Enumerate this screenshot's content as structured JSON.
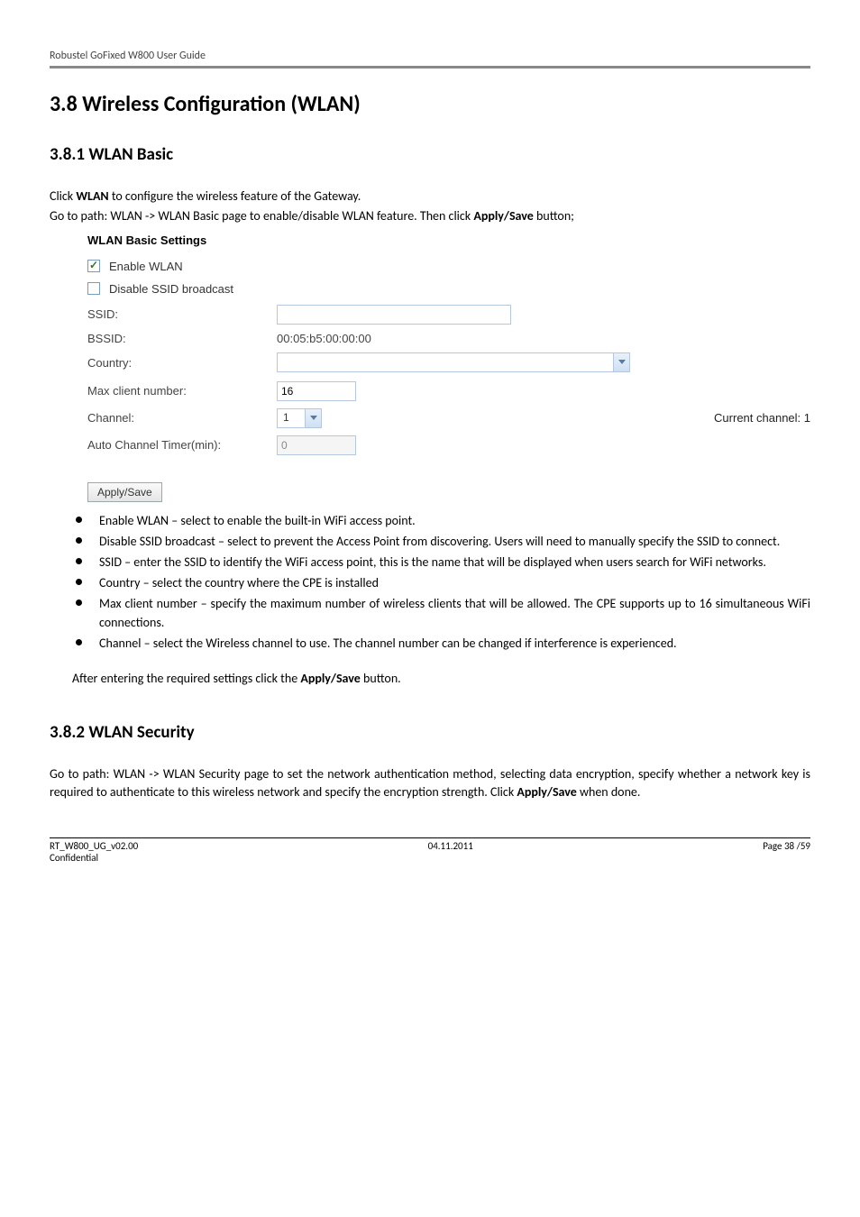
{
  "header": {
    "title": "Robustel GoFixed W800 User Guide"
  },
  "section": {
    "number_title": "3.8 Wireless Configuration (WLAN)",
    "sub1_title": "3.8.1 WLAN Basic",
    "sub2_title": "3.8.2 WLAN Security"
  },
  "intro": {
    "line1_pre": "Click ",
    "line1_bold": "WLAN",
    "line1_post": " to configure the wireless feature of the Gateway.",
    "line2_pre": "Go to path: WLAN -> WLAN Basic page to enable/disable WLAN feature. Then click ",
    "line2_bold": "Apply/Save",
    "line2_post": " button;"
  },
  "wlan": {
    "panel_title": "WLAN Basic Settings",
    "enable_label": "Enable WLAN",
    "disable_label": "Disable SSID broadcast",
    "ssid_label": "SSID:",
    "ssid_value": "",
    "bssid_label": "BSSID:",
    "bssid_value": "00:05:b5:00:00:00",
    "country_label": "Country:",
    "country_value": "",
    "max_label": "Max client number:",
    "max_value": "16",
    "channel_label": "Channel:",
    "channel_value": "1",
    "current_channel": "Current channel: 1",
    "auto_label": "Auto Channel Timer(min):",
    "auto_value": "0",
    "apply_label": "Apply/Save"
  },
  "bullets": [
    "Enable WLAN – select to enable the built-in WiFi access point.",
    "Disable SSID broadcast – select to prevent the Access Point from discovering. Users will need to manually specify the SSID to connect.",
    "SSID – enter the SSID to identify the WiFi access point, this is the name that will be displayed when users search for WiFi networks.",
    "Country – select the country where the CPE is installed",
    "Max client number – specify the maximum number of wireless clients that will be allowed. The CPE supports up to 16 simultaneous WiFi connections.",
    "Channel – select the Wireless channel to use. The channel number can be changed if interference is experienced."
  ],
  "after": {
    "pre": "After entering the required settings click the ",
    "bold": "Apply/Save",
    "post": " button."
  },
  "security_para": {
    "pre": "Go to path: WLAN -> WLAN Security page to set the network authentication method, selecting data encryption, specify whether a network key is required to authenticate to this wireless network and specify the encryption strength. Click ",
    "bold": "Apply/Save",
    "post": " when done."
  },
  "footer": {
    "doc": "RT_W800_UG_v02.00",
    "date": "04.11.2011",
    "page": "Page 38 /59",
    "conf": "Confidential"
  }
}
